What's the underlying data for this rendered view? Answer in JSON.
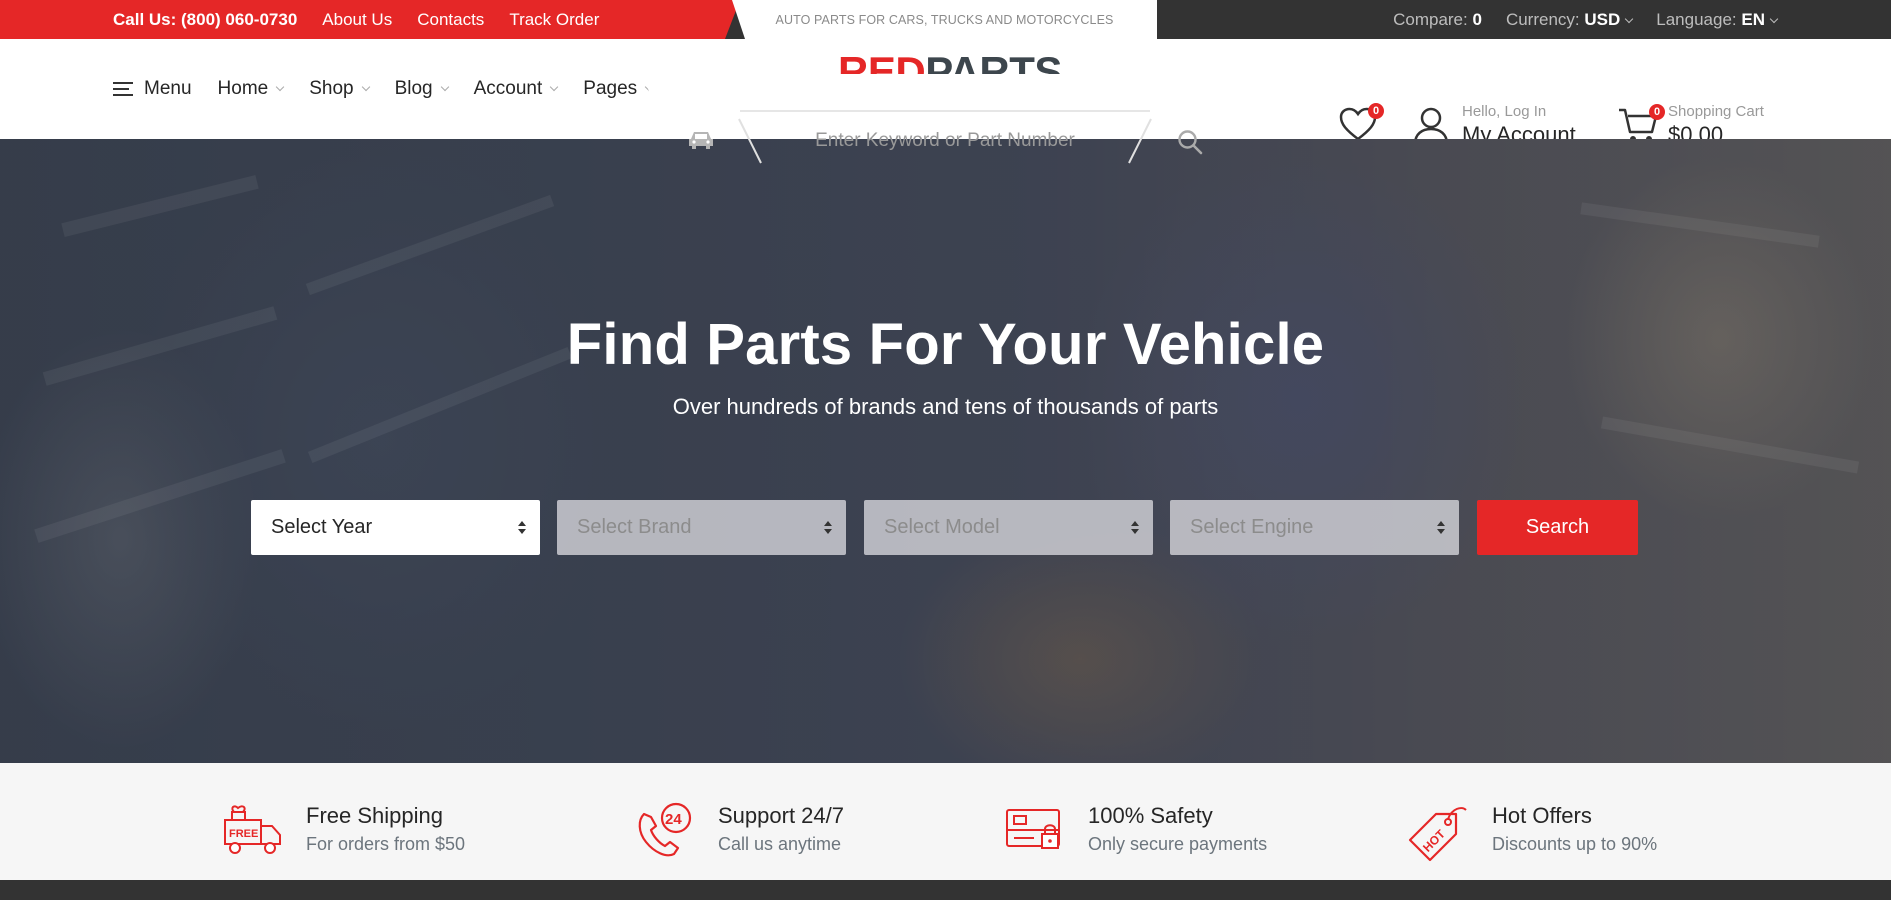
{
  "topbar": {
    "phone": "Call Us: (800) 060-0730",
    "links": [
      "About Us",
      "Contacts",
      "Track Order"
    ],
    "tagline": "AUTO PARTS FOR CARS, TRUCKS AND MOTORCYCLES",
    "compare_label": "Compare:",
    "compare_value": "0",
    "currency_label": "Currency:",
    "currency_value": "USD",
    "language_label": "Language:",
    "language_value": "EN"
  },
  "header": {
    "menu_label": "Menu",
    "nav": [
      "Home",
      "Shop",
      "Blog",
      "Account",
      "Pages"
    ],
    "logo_red": "RED",
    "logo_dark": "PARTS",
    "search_placeholder": "Enter Keyword or Part Number",
    "wishlist_count": "0",
    "account_greeting": "Hello, Log In",
    "account_title": "My Account",
    "cart_count": "0",
    "cart_label": "Shopping Cart",
    "cart_total": "$0.00"
  },
  "hero": {
    "title": "Find Parts For Your Vehicle",
    "subtitle": "Over hundreds of brands and tens of thousands of parts",
    "selects": [
      "Select Year",
      "Select Brand",
      "Select Model",
      "Select Engine"
    ],
    "search_button": "Search"
  },
  "features": [
    {
      "title": "Free Shipping",
      "subtitle": "For orders from $50",
      "icon": "free-shipping-truck-icon"
    },
    {
      "title": "Support 24/7",
      "subtitle": "Call us anytime",
      "icon": "support-24-icon"
    },
    {
      "title": "100% Safety",
      "subtitle": "Only secure payments",
      "icon": "secure-payment-card-icon"
    },
    {
      "title": "Hot Offers",
      "subtitle": "Discounts up to 90%",
      "icon": "hot-tag-icon"
    }
  ],
  "colors": {
    "accent": "#e52727",
    "dark": "#333333",
    "logo_dark": "#3d464d"
  }
}
